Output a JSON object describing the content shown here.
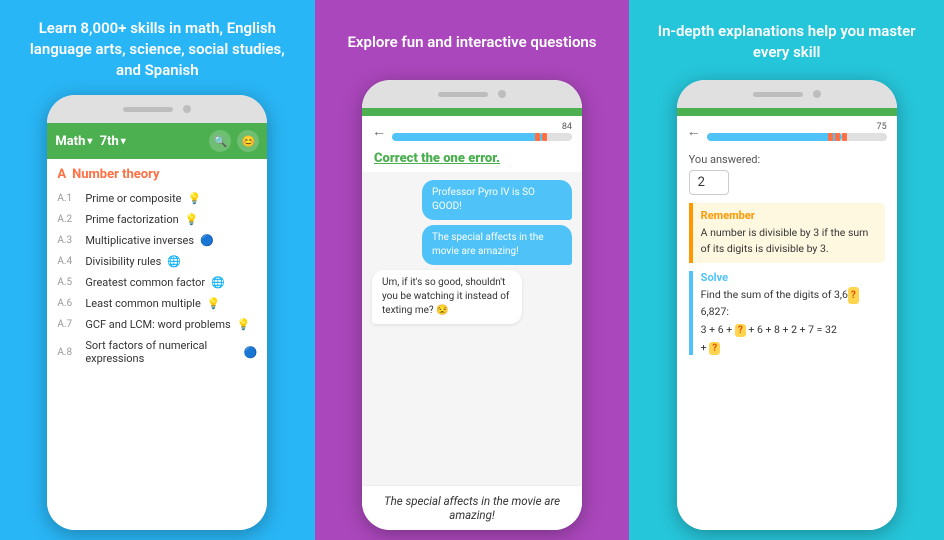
{
  "panel1": {
    "header": "Learn 8,000+ skills in math, English language arts, science, social studies, and Spanish",
    "app": {
      "subject": "Math",
      "grade": "7th",
      "section_letter": "A",
      "section_title": "Number theory",
      "skills": [
        {
          "code": "A.1",
          "label": "Prime or composite",
          "icon": "💡"
        },
        {
          "code": "A.2",
          "label": "Prime factorization",
          "icon": "💡"
        },
        {
          "code": "A.3",
          "label": "Multiplicative inverses",
          "icon": "🔵"
        },
        {
          "code": "A.4",
          "label": "Divisibility rules",
          "icon": "🌐"
        },
        {
          "code": "A.5",
          "label": "Greatest common factor",
          "icon": "🌐"
        },
        {
          "code": "A.6",
          "label": "Least common multiple",
          "icon": "💡"
        },
        {
          "code": "A.7",
          "label": "GCF and LCM: word problems",
          "icon": "💡"
        },
        {
          "code": "A.8",
          "label": "Sort factors of numerical expressions",
          "icon": "🔵"
        }
      ]
    }
  },
  "panel2": {
    "header": "Explore fun and interactive questions",
    "progress_number": "84",
    "question_prefix": "Correct the ",
    "question_bold": "one",
    "question_suffix": " error.",
    "chat": [
      {
        "type": "sent",
        "text": "Professor Pyro IV is SO GOOD!"
      },
      {
        "type": "sent",
        "text": "The special affects in the movie are amazing!"
      },
      {
        "type": "received",
        "text": "Um, if it's so good, shouldn't you be watching it instead of texting me? 😒"
      }
    ],
    "answer": "The special affects in the movie are amazing!"
  },
  "panel3": {
    "header": "In-depth explanations help you master every skill",
    "progress_number": "75",
    "you_answered_label": "You answered:",
    "user_answer": "2",
    "remember_title": "Remember",
    "remember_text": "A number is divisible by 3 if the sum of its digits is divisible by 3.",
    "solve_title": "Solve",
    "solve_text": "Find the sum of the digits of 3,6",
    "solve_number_highlight": "?",
    "solve_number_rest": "6,827:",
    "solve_equation": "3 + 6 + ",
    "solve_equation_q": "?",
    "solve_equation_rest": " + 6 + 8 + 2 + 7 = 32",
    "solve_equation2": "+ ",
    "solve_equation2_q": "?"
  }
}
